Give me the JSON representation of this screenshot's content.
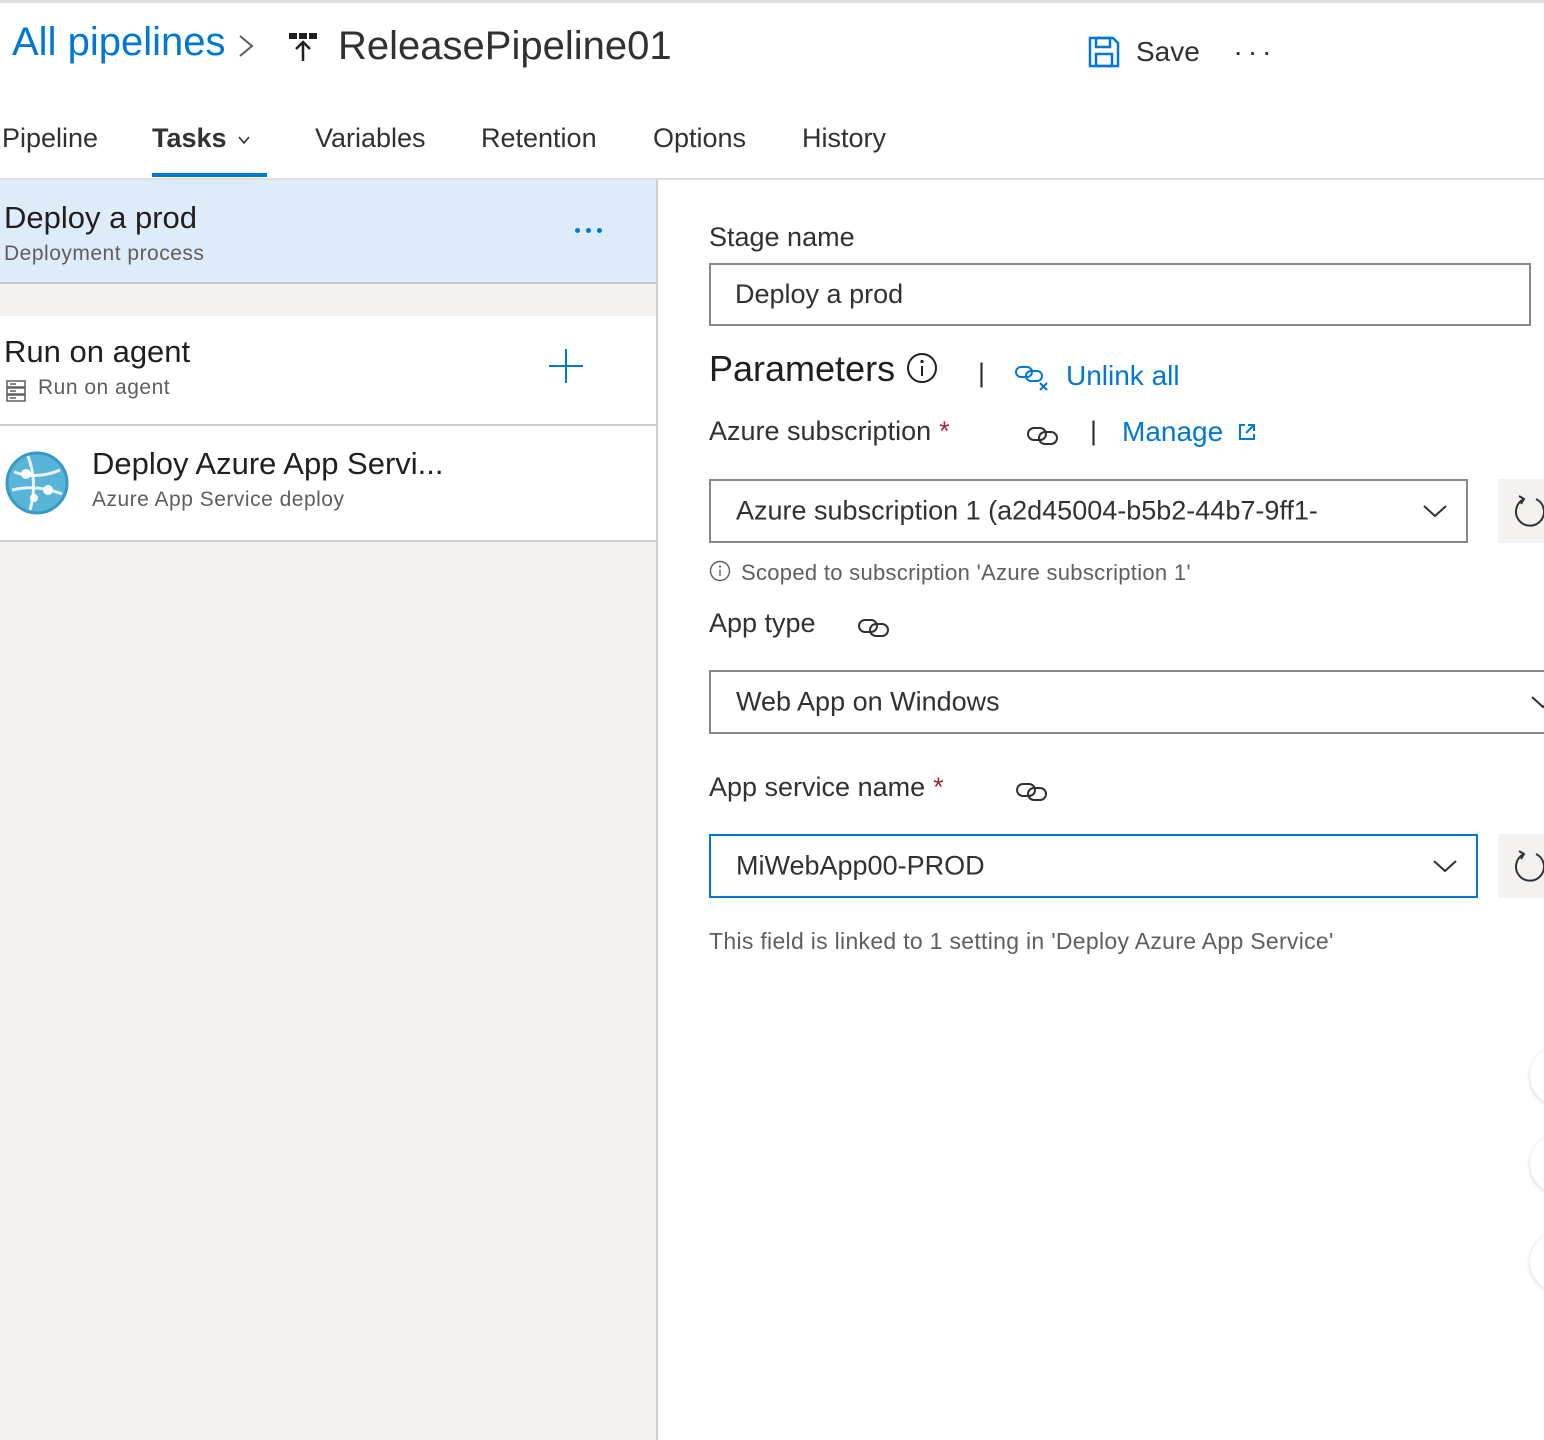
{
  "header": {
    "breadcrumb_root": "All pipelines",
    "pipeline_name": "ReleasePipeline01",
    "save_label": "Save",
    "more_label": "···"
  },
  "tabs": [
    {
      "label": "Pipeline",
      "active": false
    },
    {
      "label": "Tasks",
      "active": true
    },
    {
      "label": "Variables",
      "active": false
    },
    {
      "label": "Retention",
      "active": false
    },
    {
      "label": "Options",
      "active": false
    },
    {
      "label": "History",
      "active": false
    }
  ],
  "left_pane": {
    "stage": {
      "title": "Deploy a prod",
      "subtitle": "Deployment process"
    },
    "agent_job": {
      "title": "Run on agent",
      "subtitle": "Run on agent"
    },
    "task": {
      "title": "Deploy Azure App Servi...",
      "subtitle": "Azure App Service deploy"
    }
  },
  "stage_settings": {
    "stage_name_label": "Stage name",
    "stage_name_value": "Deploy a prod",
    "parameters_title": "Parameters",
    "separator": "|",
    "unlink_all_label": "Unlink all",
    "azure_subscription": {
      "label": "Azure subscription",
      "required_mark": "*",
      "manage_label": "Manage",
      "value": "Azure subscription 1 (a2d45004-b5b2-44b7-9ff1-",
      "hint": "Scoped to subscription 'Azure subscription 1'"
    },
    "app_type": {
      "label": "App type",
      "value": "Web App on Windows"
    },
    "app_service_name": {
      "label": "App service name",
      "required_mark": "*",
      "value": "MiWebApp00-PROD",
      "hint": "This field is linked to 1 setting in 'Deploy Azure App Service'"
    }
  },
  "colors": {
    "accent": "#0078d4",
    "selected_row": "#deecf9",
    "pane_background": "#f3f2f1",
    "required": "#a4262c"
  }
}
